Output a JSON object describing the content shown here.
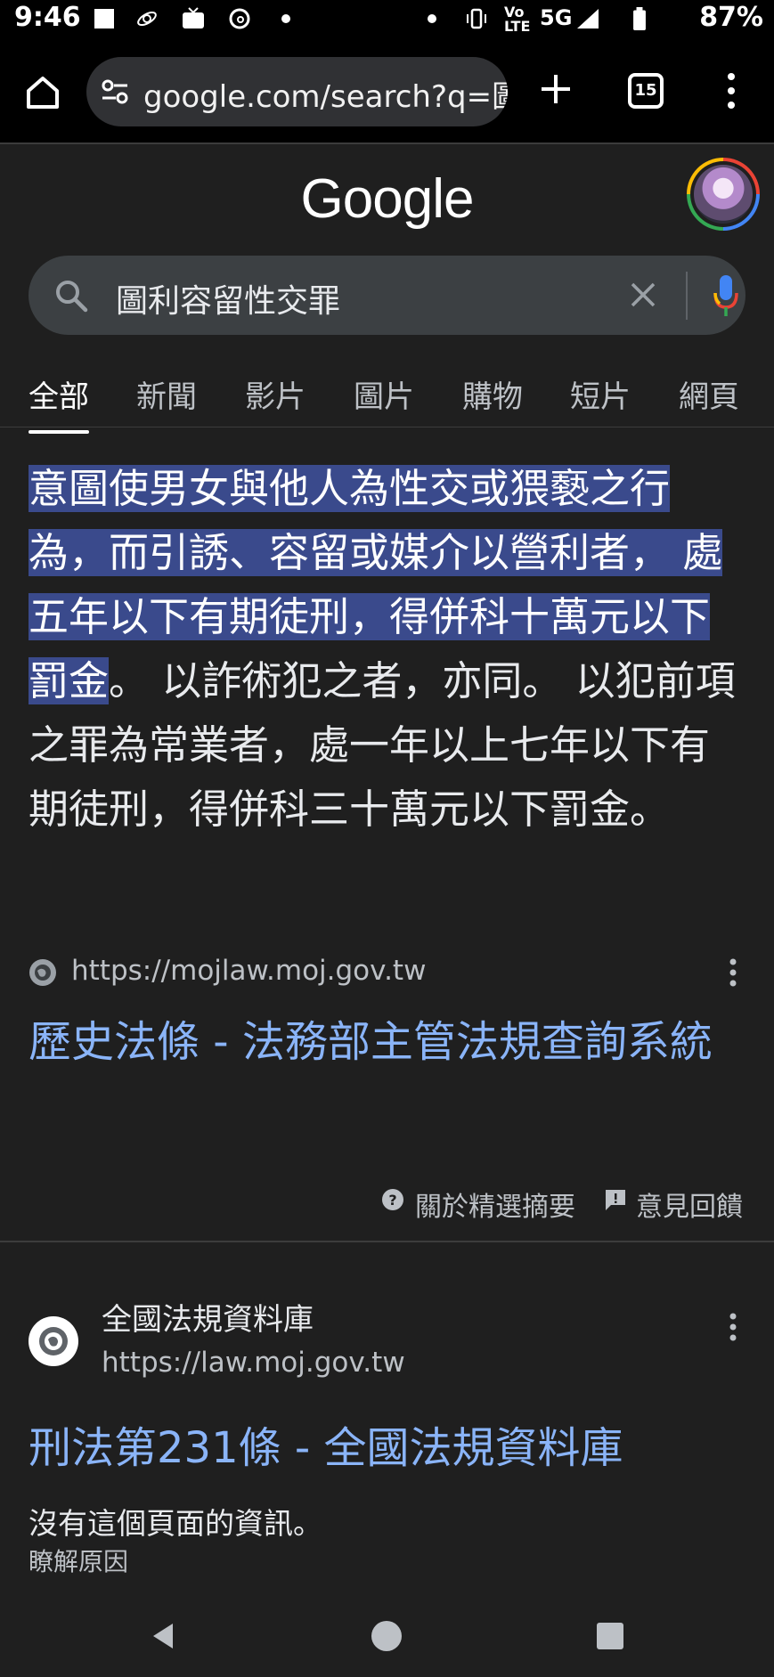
{
  "status_bar": {
    "time": "9:46",
    "network": "5G",
    "volte": "Vo LTE",
    "battery": "87%"
  },
  "browser": {
    "url": "google.com/search?q=圖",
    "tab_count": "15"
  },
  "google": {
    "logo": "Google"
  },
  "search": {
    "query": "圖利容留性交罪"
  },
  "tabs": [
    {
      "label": "全部",
      "active": true
    },
    {
      "label": "新聞"
    },
    {
      "label": "影片"
    },
    {
      "label": "圖片"
    },
    {
      "label": "購物"
    },
    {
      "label": "短片"
    },
    {
      "label": "網頁"
    }
  ],
  "featured_snippet": {
    "highlighted_text": "意圖使男女與他人為性交或猥褻之行為，而引誘、容留或媒介以營利者， 處五年以下有期徒刑，得併科十萬元以下罰金",
    "rest_text": "。 以詐術犯之者，亦同。 以犯前項之罪為常業者，處一年以上七年以下有期徒刑，得併科三十萬元以下罰金。",
    "source_url": "https://mojlaw.moj.gov.tw",
    "title": "歷史法條 - 法務部主管法規查詢系統",
    "about_label": "關於精選摘要",
    "feedback_label": "意見回饋"
  },
  "result": {
    "site_name": "全國法規資料庫",
    "site_url": "https://law.moj.gov.tw",
    "title": "刑法第231條 - 全國法規資料庫",
    "description": "沒有這個頁面的資訊。",
    "why_link": "瞭解原因"
  }
}
